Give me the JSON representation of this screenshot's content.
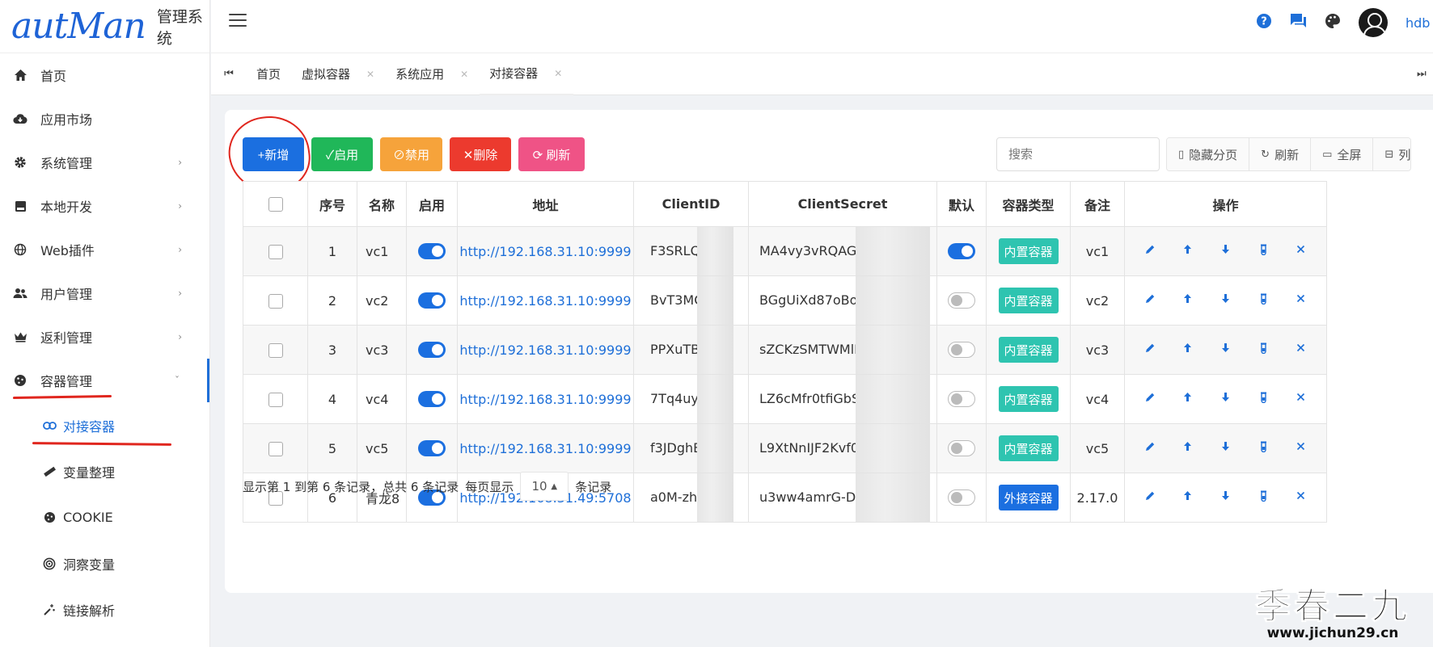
{
  "logo": {
    "brand": "autMan",
    "system": "管理系统"
  },
  "header": {
    "username": "hdb",
    "icons": [
      "help-icon",
      "chat-icon",
      "palette-icon",
      "avatar"
    ]
  },
  "sidebar": {
    "items": [
      {
        "label": "首页",
        "icon": "home-icon",
        "has_children": false
      },
      {
        "label": "应用市场",
        "icon": "cloud-download-icon",
        "has_children": false
      },
      {
        "label": "系统管理",
        "icon": "gear-icon",
        "has_children": true
      },
      {
        "label": "本地开发",
        "icon": "server-icon",
        "has_children": true
      },
      {
        "label": "Web插件",
        "icon": "globe-icon",
        "has_children": true
      },
      {
        "label": "用户管理",
        "icon": "users-icon",
        "has_children": true
      },
      {
        "label": "返利管理",
        "icon": "crown-icon",
        "has_children": true
      },
      {
        "label": "容器管理",
        "icon": "cookie-icon",
        "has_children": true,
        "expanded": true
      }
    ],
    "submenu": [
      {
        "label": "对接容器",
        "icon": "link-icon",
        "active": true
      },
      {
        "label": "变量整理",
        "icon": "ruler-icon",
        "active": false
      },
      {
        "label": "COOKIE",
        "icon": "cookie-icon",
        "active": false
      },
      {
        "label": "洞察变量",
        "icon": "target-icon",
        "active": false
      },
      {
        "label": "链接解析",
        "icon": "magic-wand-icon",
        "active": false
      }
    ]
  },
  "tabs": [
    {
      "label": "首页",
      "closable": false
    },
    {
      "label": "虚拟容器",
      "closable": true
    },
    {
      "label": "系统应用",
      "closable": true
    },
    {
      "label": "对接容器",
      "closable": true,
      "active": true
    }
  ],
  "toolbar": {
    "add": "+新增",
    "enable": "✓启用",
    "disable": "⊘禁用",
    "delete": "✕删除",
    "refresh": "⟳ 刷新"
  },
  "search": {
    "placeholder": "搜索"
  },
  "table_tools": {
    "hide_paging": "隐藏分页",
    "refresh": "刷新",
    "fullscreen": "全屏",
    "columns": "列"
  },
  "table": {
    "columns": [
      "序号",
      "名称",
      "启用",
      "地址",
      "ClientID",
      "ClientSecret",
      "默认",
      "容器类型",
      "备注",
      "操作"
    ],
    "rows": [
      {
        "idx": "1",
        "name": "vc1",
        "enabled": true,
        "address": "http://192.168.31.10:9999",
        "client_id": "F3SRLQT",
        "client_secret": "MA4vy3vRQAGx5c",
        "default": true,
        "type": "内置容器",
        "type_kind": "inner",
        "remark": "vc1"
      },
      {
        "idx": "2",
        "name": "vc2",
        "enabled": true,
        "address": "http://192.168.31.10:9999",
        "client_id": "BvT3MC",
        "client_secret": "BGgUiXd87oBohz",
        "default": false,
        "type": "内置容器",
        "type_kind": "inner",
        "remark": "vc2"
      },
      {
        "idx": "3",
        "name": "vc3",
        "enabled": true,
        "address": "http://192.168.31.10:9999",
        "client_id": "PPXuTBH",
        "client_secret": "sZCKzSMTWMlNTc",
        "default": false,
        "type": "内置容器",
        "type_kind": "inner",
        "remark": "vc3"
      },
      {
        "idx": "4",
        "name": "vc4",
        "enabled": true,
        "address": "http://192.168.31.10:9999",
        "client_id": "7Tq4uyr",
        "client_secret": "LZ6cMfr0tfiGbS(",
        "default": false,
        "type": "内置容器",
        "type_kind": "inner",
        "remark": "vc4"
      },
      {
        "idx": "5",
        "name": "vc5",
        "enabled": true,
        "address": "http://192.168.31.10:9999",
        "client_id": "f3JDghB",
        "client_secret": "L9XtNnIJF2Kvf00",
        "default": false,
        "type": "内置容器",
        "type_kind": "inner",
        "remark": "vc5"
      },
      {
        "idx": "6",
        "name": "青龙8",
        "enabled": true,
        "address": "http://192.168.31.49:5708",
        "client_id": "a0M-zhb",
        "client_secret": "u3ww4amrG-DAx",
        "default": false,
        "type": "外接容器",
        "type_kind": "outer",
        "remark": "2.17.0"
      }
    ],
    "row_actions": [
      "edit-icon",
      "move-up-icon",
      "move-down-icon",
      "test-tube-icon",
      "delete-icon"
    ]
  },
  "pager": {
    "summary": "显示第 1 到第 6 条记录，总共 6 条记录",
    "per_page_label": "每页显示",
    "page_size": "10",
    "records_label": "条记录"
  },
  "watermark": {
    "title": "季春二九",
    "url": "www.jichun29.cn"
  },
  "colors": {
    "primary": "#1b6fe0",
    "success": "#20b759",
    "warning": "#f6a33b",
    "danger": "#ec3a2e",
    "pink": "#ef5386",
    "teal": "#2ec4b0",
    "annotation": "#e0261e"
  }
}
